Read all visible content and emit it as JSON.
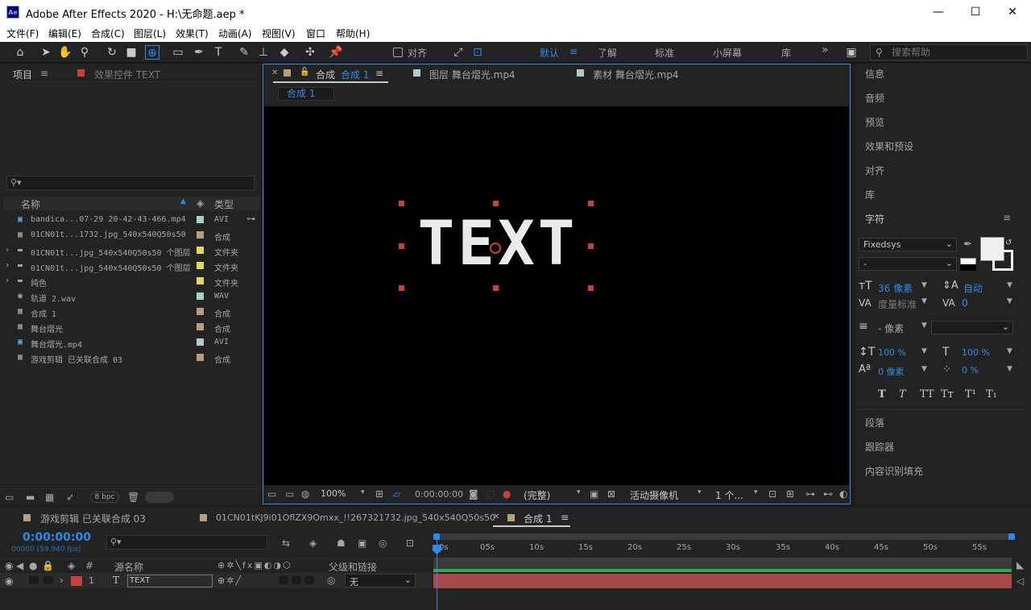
{
  "window": {
    "title": "Adobe After Effects 2020 - H:\\无命题.aep *",
    "app_badge": "Ae",
    "minimize": "—",
    "maximize": "☐",
    "close": "✕"
  },
  "menu": [
    "文件(F)",
    "编辑(E)",
    "合成(C)",
    "图层(L)",
    "效果(T)",
    "动画(A)",
    "视图(V)",
    "窗口",
    "帮助(H)"
  ],
  "toolbar": {
    "snap_label": "对齐",
    "workspaces": [
      "默认",
      "了解",
      "标准",
      "小屏幕",
      "库"
    ],
    "overflow": "»",
    "search_placeholder": "搜索帮助"
  },
  "project_panel": {
    "tab_project": "项目",
    "tab_effects": "效果控件 TEXT",
    "search_glyph": "⚲▾",
    "col_name": "名称",
    "col_type": "类型",
    "bpc": "8 bpc",
    "items": [
      {
        "name": "bandica...07-29 20-42-43-466.mp4",
        "type": "AVI",
        "color": "#a9cfcb",
        "folder": false
      },
      {
        "name": "01CN01t...1732.jpg_540x540Q50s50",
        "type": "合成",
        "color": "#b5a07c",
        "folder": false
      },
      {
        "name": "01CN01t...jpg_540x540Q50s50 个图层",
        "type": "文件夹",
        "color": "#e6d75a",
        "folder": true
      },
      {
        "name": "01CN01t...jpg_540x540Q50s50 个图层",
        "type": "文件夹",
        "color": "#e6d75a",
        "folder": true
      },
      {
        "name": "纯色",
        "type": "文件夹",
        "color": "#e6d75a",
        "folder": true
      },
      {
        "name": "轨道 2.wav",
        "type": "WAV",
        "color": "#a9cfcb",
        "folder": false
      },
      {
        "name": "合成 1",
        "type": "合成",
        "color": "#b5a07c",
        "folder": false
      },
      {
        "name": "舞台熠光",
        "type": "合成",
        "color": "#b5a07c",
        "folder": false
      },
      {
        "name": "舞台熠光.mp4",
        "type": "AVI",
        "color": "#a9cfcb",
        "folder": false
      },
      {
        "name": "游戏剪辑 已关联合成 03",
        "type": "合成",
        "color": "#b5a07c",
        "folder": false
      }
    ]
  },
  "viewer": {
    "tab_comp_prefix": "合成",
    "tab_comp_name": "合成 1",
    "tab_layer": "图层 舞台熠光.mp4",
    "tab_footage": "素材 舞台熠光.mp4",
    "breadcrumb": "合成 1",
    "canvas_text": "TEXT",
    "zoom": "100%",
    "timecode": "0:00:00:00",
    "resolution": "(完整)",
    "camera": "活动摄像机",
    "views": "1 个..."
  },
  "right_panels": {
    "items_top": [
      "信息",
      "音频",
      "预览",
      "效果和预设",
      "对齐",
      "库"
    ],
    "character_title": "字符",
    "font_family": "Fixedsys",
    "font_style": "-",
    "font_size": "36 像素",
    "leading": "自动",
    "kerning": "度量标准",
    "tracking": "0",
    "stroke": "- 像素",
    "vscale": "100 %",
    "hscale": "100 %",
    "baseline": "0 像素",
    "tsume": "0 %",
    "style_buttons": [
      "T",
      "T",
      "TT",
      "Tт",
      "T¹",
      "T₁"
    ],
    "items_bottom": [
      "段落",
      "跟踪器",
      "内容识别填充"
    ]
  },
  "timeline": {
    "tabs": [
      "游戏剪辑 已关联合成 03",
      "01CN01tKJ9i01OflZX9Omxx_!!267321732.jpg_540x540Q50s50",
      "合成 1"
    ],
    "timecode": "0:00:00:00",
    "fps": "00000 (59.940 fps)",
    "search_glyph": "⚲▾",
    "col_source": "源名称",
    "col_parent": "父级和链接",
    "ticks": [
      "0s",
      "05s",
      "10s",
      "15s",
      "20s",
      "25s",
      "30s",
      "35s",
      "40s",
      "45s",
      "50s",
      "55s"
    ],
    "layer": {
      "index": "1",
      "name": "TEXT",
      "parent": "无",
      "label_color": "#c8413f"
    }
  }
}
